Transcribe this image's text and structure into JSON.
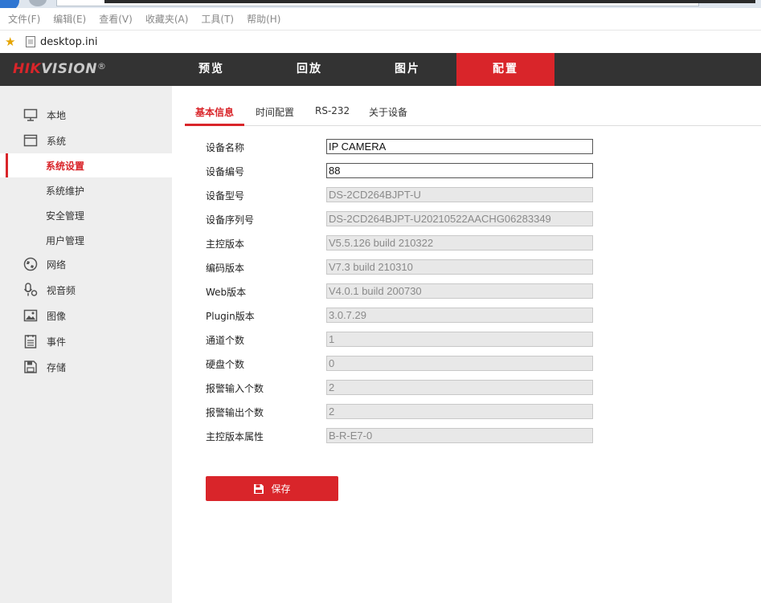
{
  "browser": {
    "menu": [
      "文件(F)",
      "编辑(E)",
      "查看(V)",
      "收藏夹(A)",
      "工具(T)",
      "帮助(H)"
    ],
    "favorite": "desktop.ini"
  },
  "header": {
    "logo_hik": "HIK",
    "logo_vision": "VISION",
    "logo_reg": "®",
    "nav": [
      "预览",
      "回放",
      "图片",
      "配置"
    ],
    "active_nav": "配置"
  },
  "sidebar": {
    "items": [
      {
        "label": "本地",
        "icon": "monitor-icon"
      },
      {
        "label": "系统",
        "icon": "system-icon"
      },
      {
        "label": "系统设置",
        "sub": true,
        "active": true
      },
      {
        "label": "系统维护",
        "sub": true
      },
      {
        "label": "安全管理",
        "sub": true
      },
      {
        "label": "用户管理",
        "sub": true
      },
      {
        "label": "网络",
        "icon": "globe-icon"
      },
      {
        "label": "视音频",
        "icon": "microphone-icon"
      },
      {
        "label": "图像",
        "icon": "image-icon"
      },
      {
        "label": "事件",
        "icon": "event-list-icon"
      },
      {
        "label": "存储",
        "icon": "floppy-disk-icon"
      }
    ]
  },
  "tabs": [
    "基本信息",
    "时间配置",
    "RS-232",
    "关于设备"
  ],
  "form": [
    {
      "label": "设备名称",
      "value": "IP CAMERA",
      "editable": true
    },
    {
      "label": "设备编号",
      "value": "88",
      "editable": true
    },
    {
      "label": "设备型号",
      "value": "DS-2CD264BJPT-U",
      "editable": false
    },
    {
      "label": "设备序列号",
      "value": "DS-2CD264BJPT-U20210522AACHG06283349",
      "editable": false
    },
    {
      "label": "主控版本",
      "value": "V5.5.126 build 210322",
      "editable": false
    },
    {
      "label": "编码版本",
      "value": "V7.3 build 210310",
      "editable": false
    },
    {
      "label": "Web版本",
      "value": "V4.0.1 build 200730",
      "editable": false
    },
    {
      "label": "Plugin版本",
      "value": "3.0.7.29",
      "editable": false
    },
    {
      "label": "通道个数",
      "value": "1",
      "editable": false
    },
    {
      "label": "硬盘个数",
      "value": "0",
      "editable": false
    },
    {
      "label": "报警输入个数",
      "value": "2",
      "editable": false
    },
    {
      "label": "报警输出个数",
      "value": "2",
      "editable": false
    },
    {
      "label": "主控版本属性",
      "value": "B-R-E7-0",
      "editable": false
    }
  ],
  "save_label": "保存",
  "colors": {
    "accent": "#d9252a",
    "header_bg": "#333333",
    "sidebar_bg": "#eeeeee"
  }
}
